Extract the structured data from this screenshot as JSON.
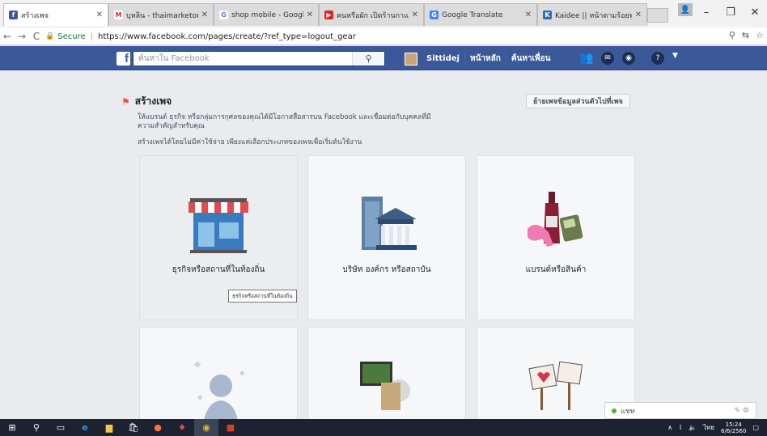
{
  "browser": {
    "tabs": [
      {
        "label": "สร้างเพจ",
        "icon": "facebook-icon",
        "color": "#3b5998",
        "active": true
      },
      {
        "label": "บุหลิน - thaimarketonline",
        "icon": "gmail-icon",
        "color": "#d93025",
        "active": false
      },
      {
        "label": "shop mobile - Google S",
        "icon": "google-icon",
        "color": "#4285f4",
        "active": false
      },
      {
        "label": "คนหรือผัก เปิดร้านกาแฟ",
        "icon": "youtube-icon",
        "color": "#e62117",
        "active": false
      },
      {
        "label": "Google Translate",
        "icon": "translate-icon",
        "color": "#4285f4",
        "active": false
      },
      {
        "label": "Kaidee || หน้าตามร้อยพูดอ",
        "icon": "kaidee-icon",
        "color": "#2c6fb7",
        "active": false
      }
    ],
    "secure_label": "Secure",
    "url": "https://www.facebook.com/pages/create/?ref_type=logout_gear"
  },
  "fb": {
    "search_placeholder": "ค้นหาใน Facebook",
    "user_name": "Sittidej",
    "nav_home": "หน้าหลัก",
    "nav_find_friends": "ค้นหาเพื่อน"
  },
  "page": {
    "title": "สร้างเพจ",
    "move_button": "ย้ายเพจข้อมูลส่วนตัวไปที่เพจ",
    "desc_line1": "ให้แบรนด์ ธุรกิจ หรือกลุ่มการกุศลของคุณได้มีโอกาสสื่อสารบน Facebook และเชื่อมต่อกับบุคคลที่มี",
    "desc_line2": "ความสำคัญสำหรับคุณ",
    "desc_line3": "สร้างเพจได้โดยไม่มีค่าใช้จ่าย เพียงแค่เลือกประเภทของเพจเพื่อเริ่มต้นใช้งาน",
    "cards": [
      {
        "label": "ธุรกิจหรือสถานที่ในท้องถิ่น",
        "icon": "storefront-icon"
      },
      {
        "label": "บริษัท องค์กร หรือสถาบัน",
        "icon": "building-icon"
      },
      {
        "label": "แบรนด์หรือสินค้า",
        "icon": "products-icon"
      },
      {
        "label": "",
        "icon": "public-figure-icon"
      },
      {
        "label": "",
        "icon": "entertainment-icon"
      },
      {
        "label": "",
        "icon": "cause-icon"
      }
    ],
    "tooltip": "ธุรกิจหรือสถานที่ในท้องถิ่น"
  },
  "chat": {
    "label": "แชท"
  },
  "taskbar": {
    "time": "15:24",
    "date": "6/6/2560",
    "lang": "ไทย"
  }
}
